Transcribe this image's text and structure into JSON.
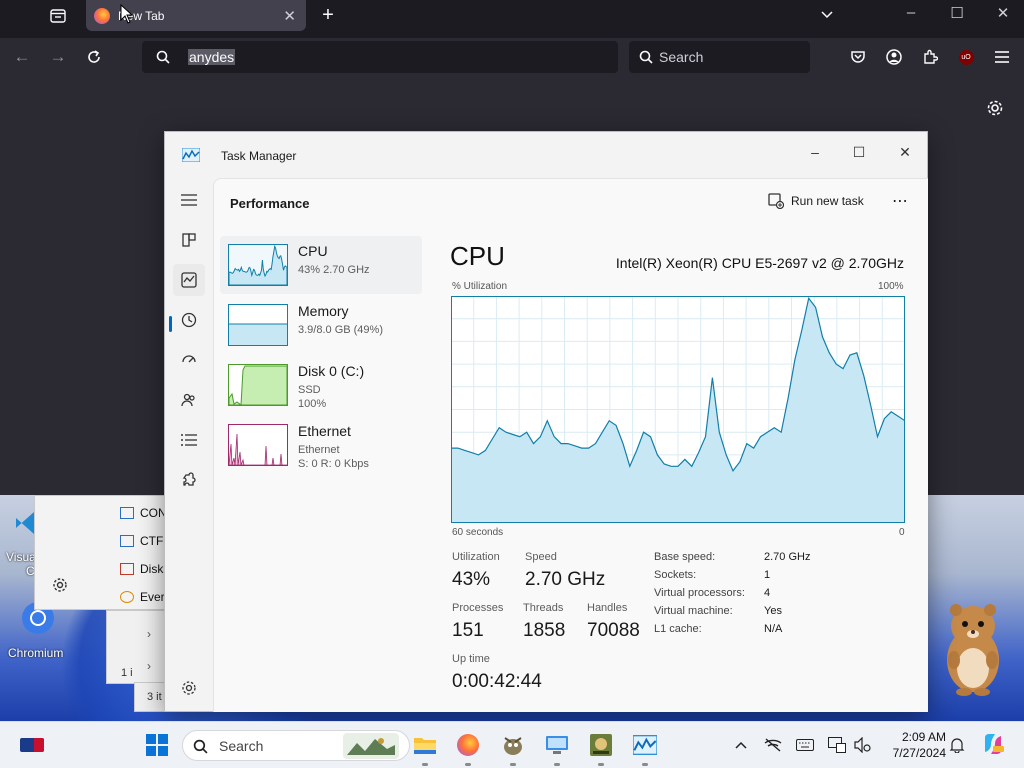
{
  "browser": {
    "tab_title": "New Tab",
    "url_value": "anydes",
    "search_placeholder": "Search"
  },
  "desktop": {
    "icons": [
      {
        "label": "Visua",
        "icon": "vscode-icon"
      },
      {
        "label": "C",
        "icon": ""
      },
      {
        "label": "Chromium",
        "icon": "chromium-icon"
      }
    ],
    "explorer_items": [
      "CON",
      "CTF",
      "Disk",
      "Ever"
    ],
    "explorer_status_1": "1 i",
    "explorer_status_2": "3 it"
  },
  "task_manager": {
    "window_title": "Task Manager",
    "page_title": "Performance",
    "run_new_task": "Run new task",
    "more": "⋯",
    "devices": [
      {
        "name": "CPU",
        "sub1": "43%  2.70 GHz",
        "sub2": "",
        "sub3": ""
      },
      {
        "name": "Memory",
        "sub1": "3.9/8.0 GB (49%)",
        "sub2": "",
        "sub3": ""
      },
      {
        "name": "Disk 0 (C:)",
        "sub1": "SSD",
        "sub2": "100%",
        "sub3": ""
      },
      {
        "name": "Ethernet",
        "sub1": "Ethernet",
        "sub2": "S: 0  R: 0 Kbps",
        "sub3": ""
      }
    ],
    "cpu": {
      "title": "CPU",
      "model": "Intel(R) Xeon(R) CPU E5-2697 v2 @ 2.70GHz",
      "y_label": "% Utilization",
      "y_max_label": "100%",
      "x_left_label": "60 seconds",
      "x_right_label": "0",
      "utilization_label": "Utilization",
      "utilization": "43%",
      "speed_label": "Speed",
      "speed": "2.70 GHz",
      "processes_label": "Processes",
      "processes": "151",
      "threads_label": "Threads",
      "threads": "1858",
      "handles_label": "Handles",
      "handles": "70088",
      "uptime_label": "Up time",
      "uptime": "0:00:42:44",
      "specs": [
        {
          "label": "Base speed:",
          "value": "2.70 GHz"
        },
        {
          "label": "Sockets:",
          "value": "1"
        },
        {
          "label": "Virtual processors:",
          "value": "4"
        },
        {
          "label": "Virtual machine:",
          "value": "Yes"
        },
        {
          "label": "L1 cache:",
          "value": "N/A"
        }
      ]
    },
    "history_percent": [
      33,
      33,
      32,
      31,
      30,
      32,
      37,
      42,
      40,
      39,
      38,
      40,
      35,
      38,
      45,
      38,
      35,
      35,
      34,
      33,
      33,
      35,
      40,
      45,
      43,
      35,
      25,
      32,
      40,
      38,
      30,
      26,
      25,
      25,
      28,
      25,
      31,
      38,
      64,
      40,
      30,
      23,
      27,
      35,
      33,
      38,
      40,
      42,
      40,
      55,
      72,
      85,
      99,
      95,
      82,
      75,
      70,
      68,
      74,
      75,
      65,
      52,
      38,
      46,
      49,
      47,
      45
    ]
  },
  "taskbar": {
    "search_label": "Search",
    "time": "2:09 AM",
    "date": "7/27/2024"
  },
  "colors": {
    "graph_fill": "#c7e7f5",
    "graph_line": "#117fa8",
    "graph_grid": "#d9ecf4",
    "graph_border": "#117fa8",
    "memory_color": "#7b57b5",
    "disk_color": "#4c9a2a",
    "ethernet_color": "#a0286b"
  }
}
